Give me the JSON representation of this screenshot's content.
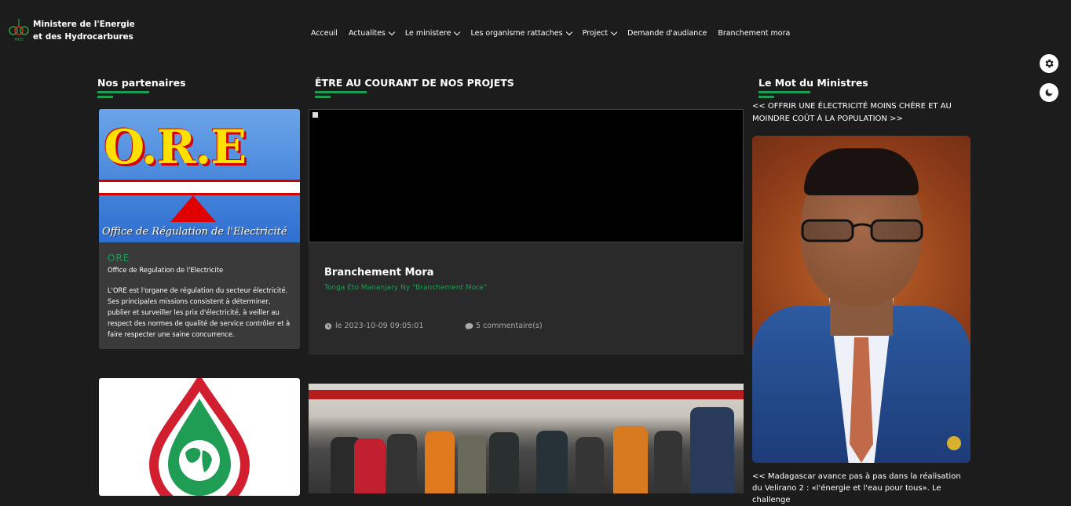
{
  "header": {
    "logo_line1": "Ministere de l'Energie",
    "logo_line2": "et des Hydrocarbures",
    "logo_mark_text": "MEH"
  },
  "nav": [
    {
      "label": "Acceuil",
      "dropdown": false
    },
    {
      "label": "Actualites",
      "dropdown": true
    },
    {
      "label": "Le ministere",
      "dropdown": true
    },
    {
      "label": "Les organisme rattaches",
      "dropdown": true
    },
    {
      "label": "Project",
      "dropdown": true
    },
    {
      "label": "Demande d'audiance",
      "dropdown": false
    },
    {
      "label": "Branchement mora",
      "dropdown": false
    }
  ],
  "sections": {
    "partners_title": "Nos partenaires",
    "projects_title": "ÊTRE AU COURANT DE NOS PROJETS",
    "minister_title": "Le Mot du Ministres"
  },
  "partners": [
    {
      "image_text": "O.R.E",
      "image_subtitle": "Office de Régulation de l'Electricité",
      "tag": "ORE",
      "name": "Office de Regulation de l'Electricite",
      "description": "L'ORE est l'organe de régulation du secteur électricité. Ses principales missions consistent à déterminer, publier et surveiller les prix d'électricité, à veiller au respect des normes de qualité de service contrôler et à faire respecter une saine concurrence."
    }
  ],
  "project": {
    "title": "Branchement Mora",
    "subtitle": "Tonga Eto Mananjary Ny “Branchement Mora”",
    "date": "le 2023-10-09 09:05:01",
    "comments": "5 commentaire(s)"
  },
  "minister": {
    "quote1": "<< OFFRIR UNE ÉLECTRICITÉ MOINS CHÈRE ET AU MOINDRE COÛT À LA POPULATION >>",
    "quote2": "<< Madagascar avance pas à pas dans la réalisation du Velirano 2 : «l'énergie et l'eau pour tous». Le challenge"
  },
  "icons": {
    "settings": "gear-icon",
    "theme": "moon-icon",
    "clock": "clock-icon",
    "comment": "comment-icon"
  },
  "colors": {
    "accent": "#1f9d55",
    "background": "#1c1c1c",
    "card": "#3a3a3a"
  }
}
